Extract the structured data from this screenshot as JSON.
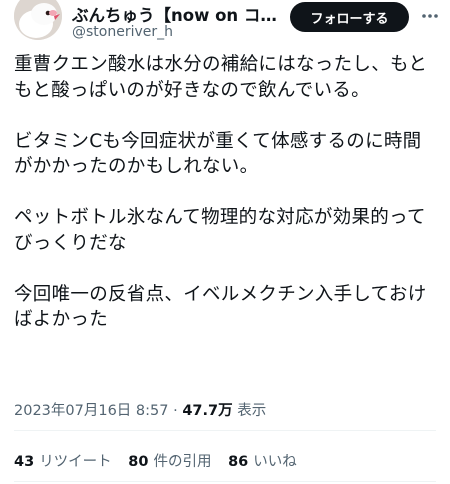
{
  "author": {
    "name": "ぶんちゅう【now on コ…",
    "handle": "@stoneriver_h"
  },
  "follow_label": "フォローする",
  "tweet": {
    "paragraphs": [
      "重曹クエン酸水は水分の補給にはなったし、もともと酸っぱいのが好きなので飲んでいる。",
      "ビタミンCも今回症状が重くて体感するのに時間がかかったのかもしれない。",
      "ペットボトル氷なんて物理的な対応が効果的ってびっくりだな",
      "今回唯一の反省点、イベルメクチン入手しておけばよかった"
    ]
  },
  "meta": {
    "timestamp": "2023年07月16日 8:57",
    "separator": "·",
    "views_count": "47.7万",
    "views_label": "表示"
  },
  "stats": [
    {
      "count": "43",
      "label": "リツイート"
    },
    {
      "count": "80",
      "label": "件の引用"
    },
    {
      "count": "86",
      "label": "いいね"
    }
  ],
  "colors": {
    "text": "#0f1419",
    "muted": "#536471",
    "button_bg": "#0f1419",
    "button_text": "#ffffff",
    "divider": "#eff3f4"
  }
}
